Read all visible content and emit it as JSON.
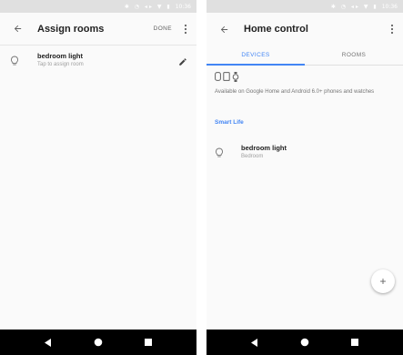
{
  "colors": {
    "accent": "#4285f4",
    "status_bar": "#e0e0e0",
    "nav_bar": "#000000"
  },
  "left_screen": {
    "status_time": "10:36",
    "appbar": {
      "title": "Assign rooms",
      "action_label": "DONE",
      "back_icon": "arrow-back-icon",
      "more_icon": "more-vert-icon"
    },
    "device": {
      "name": "bedroom light",
      "subtitle": "Tap to assign room",
      "icon": "lightbulb-icon",
      "edit_icon": "pencil-icon"
    }
  },
  "right_screen": {
    "status_time": "10:36",
    "appbar": {
      "title": "Home control",
      "back_icon": "arrow-back-icon",
      "more_icon": "more-vert-icon"
    },
    "tabs": [
      {
        "label": "DEVICES",
        "active": true
      },
      {
        "label": "ROOMS",
        "active": false
      }
    ],
    "availability_text": "Available on Google Home and Android 6.0+ phones and watches",
    "section_title": "Smart Life",
    "device": {
      "name": "bedroom light",
      "room": "Bedroom",
      "icon": "lightbulb-icon"
    },
    "fab_label": "+"
  }
}
